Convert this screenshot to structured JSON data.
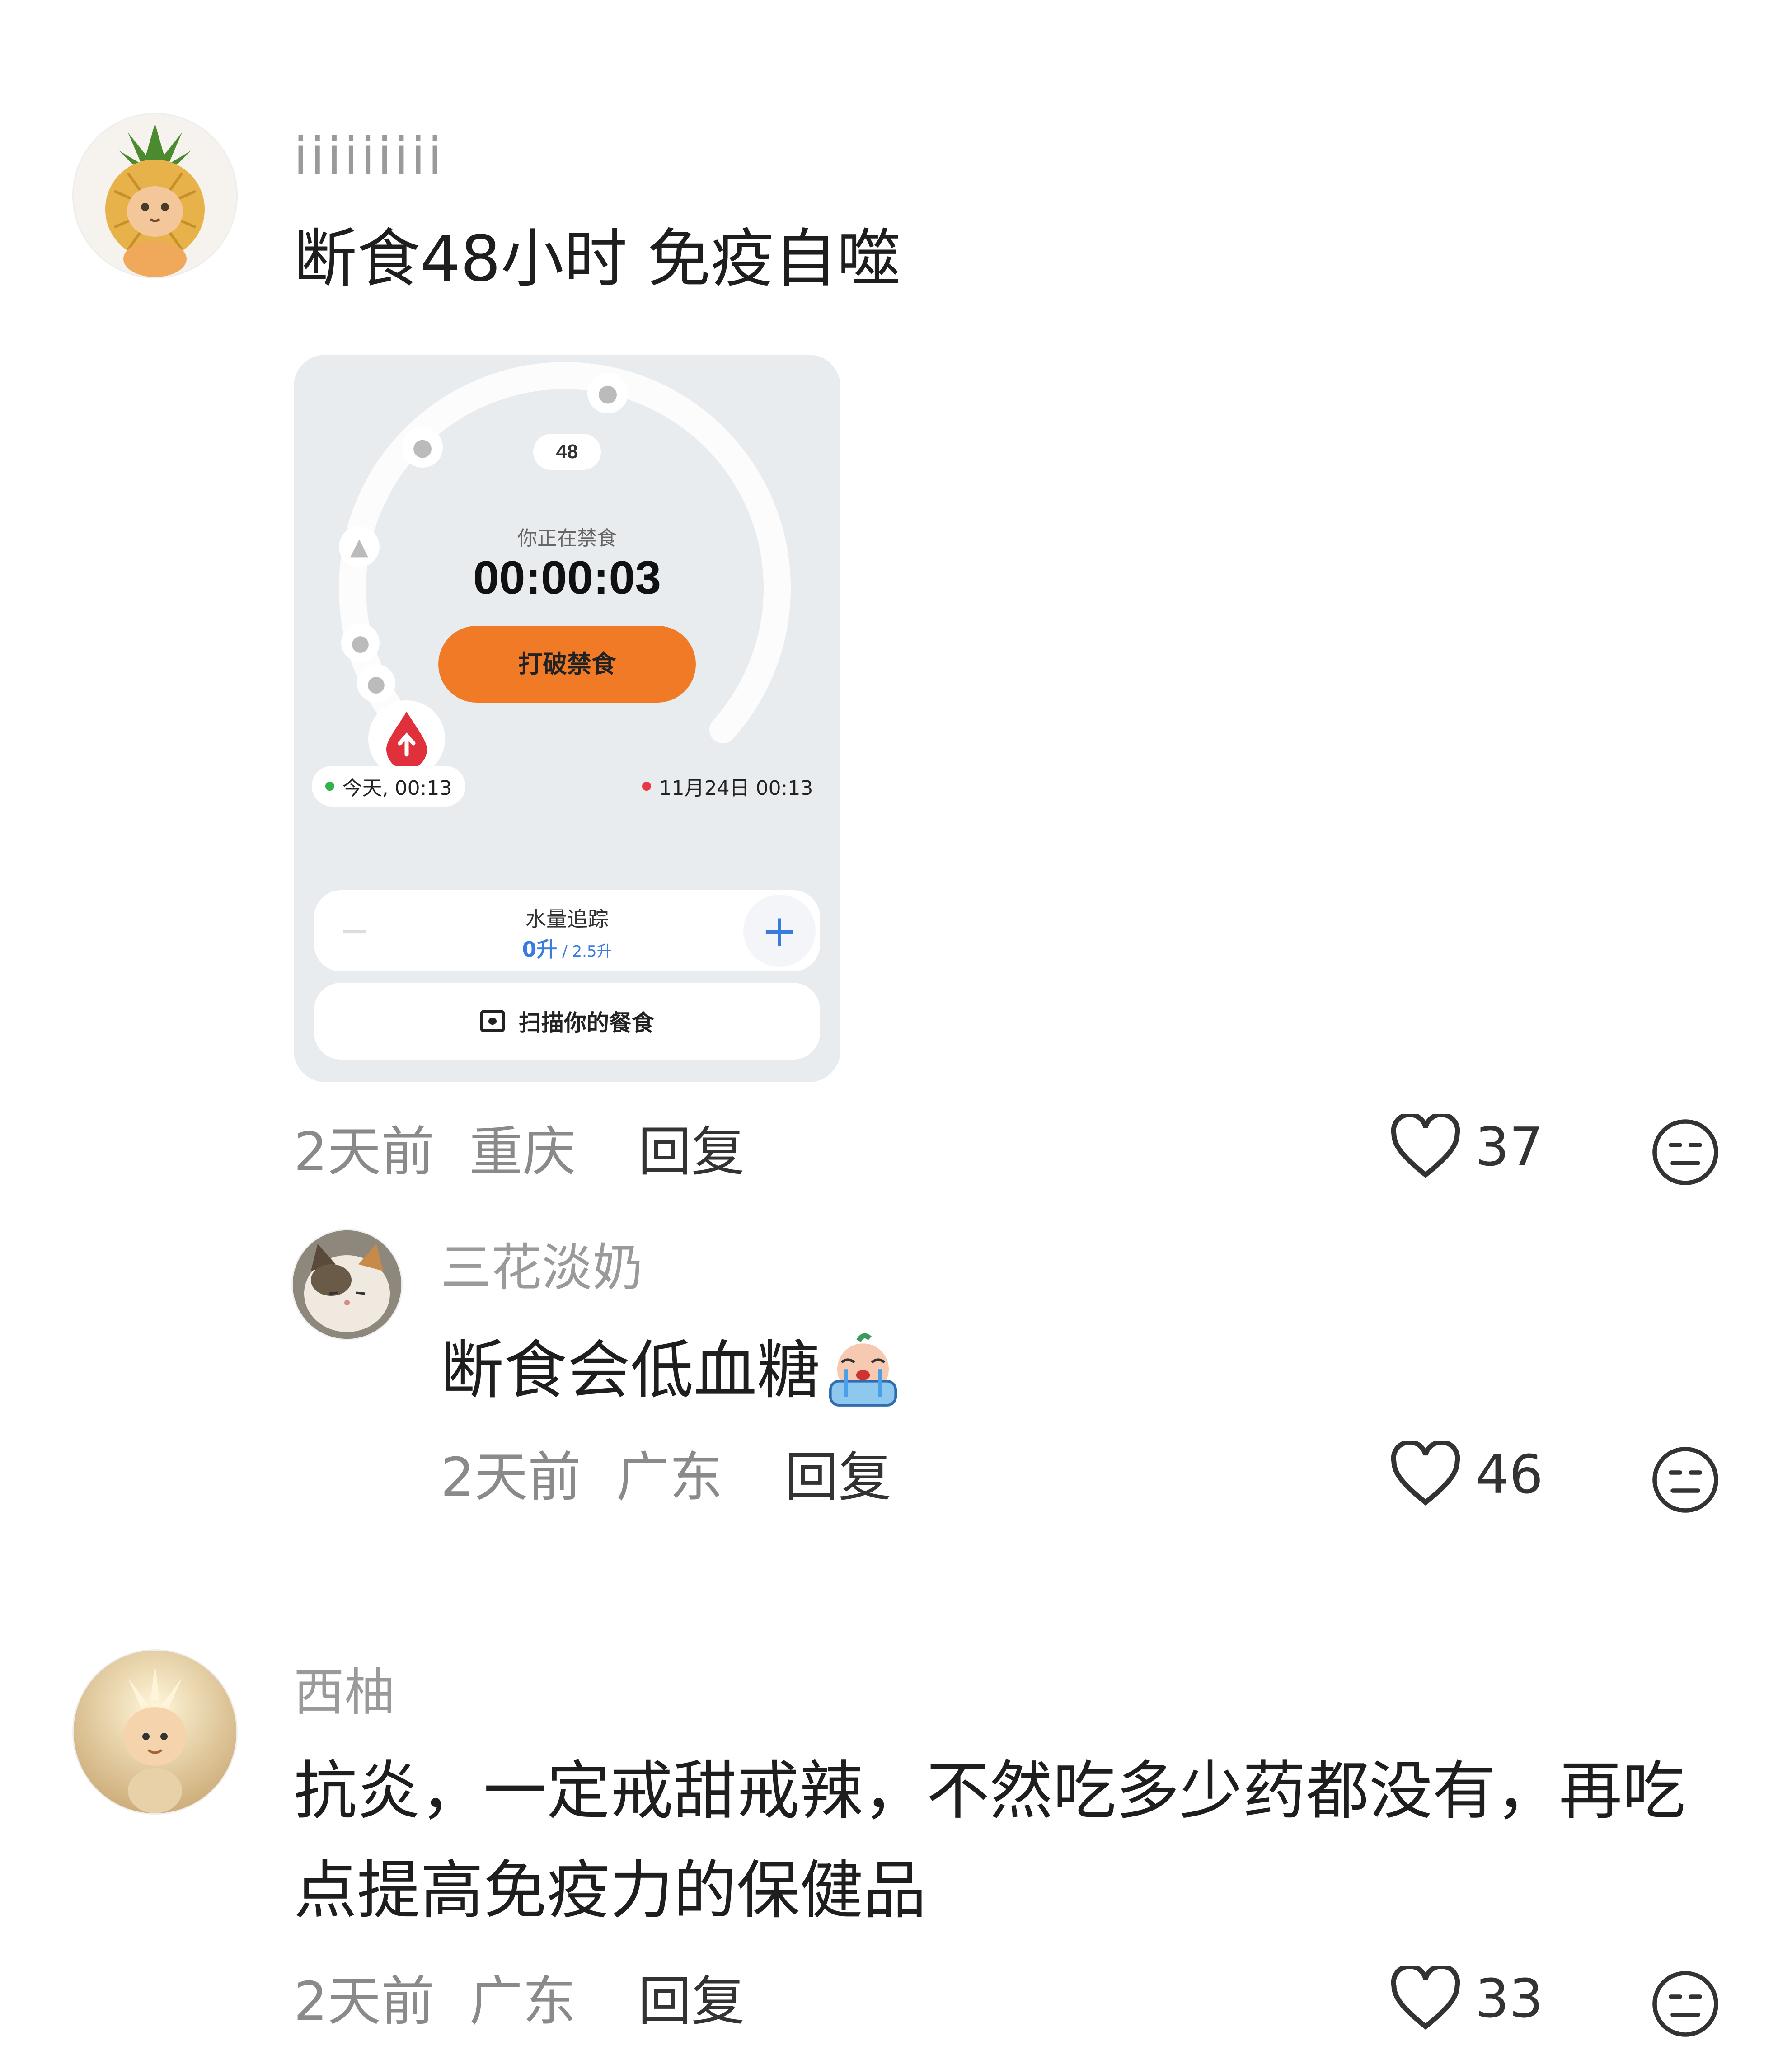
{
  "comments": [
    {
      "username": "iiiiiiiii",
      "text": "断食48小时 免疫自噬",
      "time": "2天前",
      "location": "重庆",
      "reply_label": "回复",
      "likes": "37",
      "attachment": {
        "ring_hours": "48",
        "status": "你正在禁食",
        "timer": "00:00:03",
        "break_button": "打破禁食",
        "start_time": "今天, 00:13",
        "end_time": "11月24日 00:13",
        "water_title": "水量追踪",
        "water_current": "0升",
        "water_goal": " / 2.5升",
        "water_minus": "−",
        "water_plus": "+",
        "scan_label": "扫描你的餐食"
      }
    },
    {
      "username": "三花淡奶",
      "text": "断食会低血糖",
      "time": "2天前",
      "location": "广东",
      "reply_label": "回复",
      "likes": "46"
    },
    {
      "username": "西柚",
      "text": "抗炎，一定戒甜戒辣，不然吃多少药都没有，再吃点提高免疫力的保健品",
      "time": "2天前",
      "location": "广东",
      "reply_label": "回复",
      "likes": "33"
    }
  ],
  "icons": {
    "like": "heart-outline-icon",
    "dislike": "neutral-face-icon",
    "emoji": "crying-face-emoji"
  },
  "colors": {
    "accent_orange": "#f07a25",
    "blood_red": "#e0303b",
    "start_dot": "#2fb34a",
    "end_dot": "#e53a45",
    "water_blue": "#3a7be0"
  }
}
